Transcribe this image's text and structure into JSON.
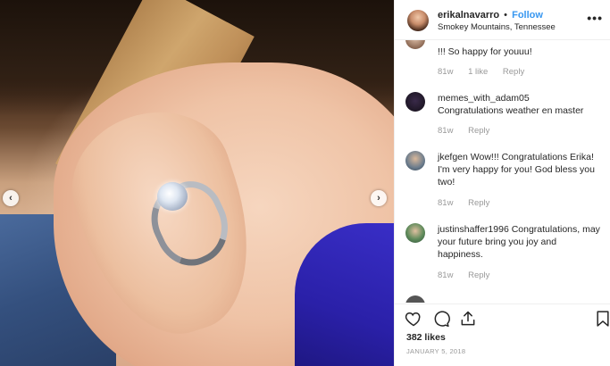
{
  "post": {
    "username": "erikalnavarro",
    "separator": "•",
    "follow_label": "Follow",
    "location": "Smokey Mountains, Tennessee",
    "more_label": "•••"
  },
  "comments": [
    {
      "username": "",
      "text": "!!! So happy for youuu!",
      "time": "81w",
      "likes": "1 like",
      "reply": "Reply"
    },
    {
      "username": "memes_with_adam05",
      "text": "Congratulations weather en master",
      "time": "81w",
      "likes": "",
      "reply": "Reply"
    },
    {
      "username": "jkefgen",
      "text": "Wow!!! Congratulations Erika! I'm very happy for you! God bless you two!",
      "time": "81w",
      "likes": "",
      "reply": "Reply"
    },
    {
      "username": "justinshaffer1996",
      "text": "Congratulations, may your future bring you joy and happiness.",
      "time": "81w",
      "likes": "",
      "reply": "Reply"
    }
  ],
  "actions": {
    "likes_text": "382 likes",
    "date": "JANUARY 5, 2018"
  },
  "carousel": {
    "prev_glyph": "‹",
    "next_glyph": "›"
  },
  "colors": {
    "follow_blue": "#3897f0",
    "meta_gray": "#999999",
    "text": "#262626",
    "border": "#efefef"
  },
  "icons": [
    "heart-icon",
    "comment-icon",
    "share-icon",
    "bookmark-icon",
    "more-options-icon",
    "chevron-left-icon",
    "chevron-right-icon"
  ]
}
